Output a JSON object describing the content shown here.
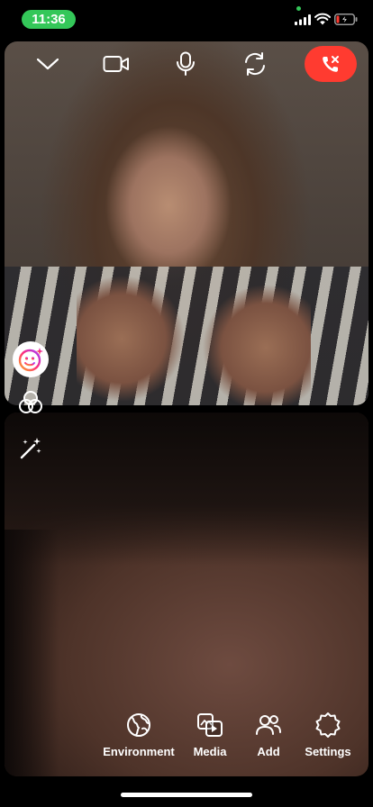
{
  "status_bar": {
    "time": "11:36",
    "accent_color": "#34c759",
    "battery_state": "charging-low"
  },
  "call_controls": {
    "items": [
      {
        "name": "collapse",
        "icon": "chevron-down-icon"
      },
      {
        "name": "video",
        "icon": "video-camera-icon"
      },
      {
        "name": "microphone",
        "icon": "microphone-icon"
      },
      {
        "name": "flip-camera",
        "icon": "flip-camera-icon"
      },
      {
        "name": "end-call",
        "icon": "end-call-icon",
        "color": "#ff3b30"
      }
    ]
  },
  "side_tools": {
    "effects_icon": "face-effects-icon",
    "filters_icon": "filters-icon",
    "wand_icon": "magic-wand-icon"
  },
  "bottom_menu": {
    "environment": "Environment",
    "media": "Media",
    "add": "Add",
    "settings": "Settings"
  }
}
